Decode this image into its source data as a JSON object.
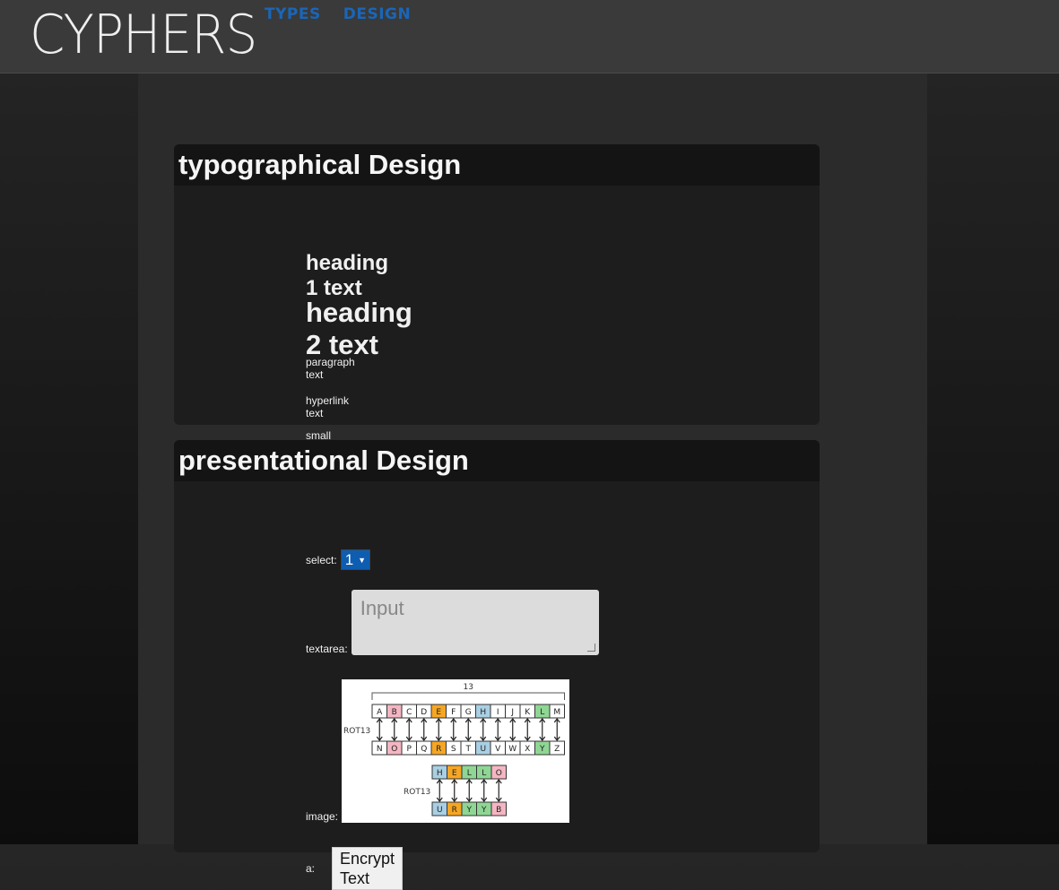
{
  "header": {
    "logo": "CYPHERS",
    "nav": [
      "TYPES",
      "DESIGN"
    ]
  },
  "typography": {
    "title": "typographical Design",
    "heading1": "heading 1 text",
    "heading2": "heading 2 text",
    "paragraph": "paragraph text",
    "hyperlink": "hyperlink text",
    "small": "small text"
  },
  "presentation": {
    "title": "presentational Design",
    "select_label": "select:",
    "select_value": "1",
    "textarea_label": "textarea:",
    "textarea_placeholder": "Input",
    "image_label": "image:",
    "a_label": "a:",
    "button_label": "Encrypt Text"
  },
  "rot13_image": {
    "count_label": "13",
    "side_label": "ROT13",
    "top_row": [
      "A",
      "B",
      "C",
      "D",
      "E",
      "F",
      "G",
      "H",
      "I",
      "J",
      "K",
      "L",
      "M"
    ],
    "bottom_row": [
      "N",
      "O",
      "P",
      "Q",
      "R",
      "S",
      "T",
      "U",
      "V",
      "W",
      "X",
      "Y",
      "Z"
    ],
    "word_plain": [
      "H",
      "E",
      "L",
      "L",
      "O"
    ],
    "word_cipher": [
      "U",
      "R",
      "Y",
      "Y",
      "B"
    ],
    "colors": {
      "pink": "#f4b6c2",
      "orange": "#f5a623",
      "blue": "#a9cfe3",
      "green": "#8fd694"
    }
  },
  "colors": {
    "nav_link": "#1a66b8",
    "select_bg": "#0f5db0",
    "panel_bg": "#1d1d1d",
    "panel_header_bg": "#141414"
  }
}
